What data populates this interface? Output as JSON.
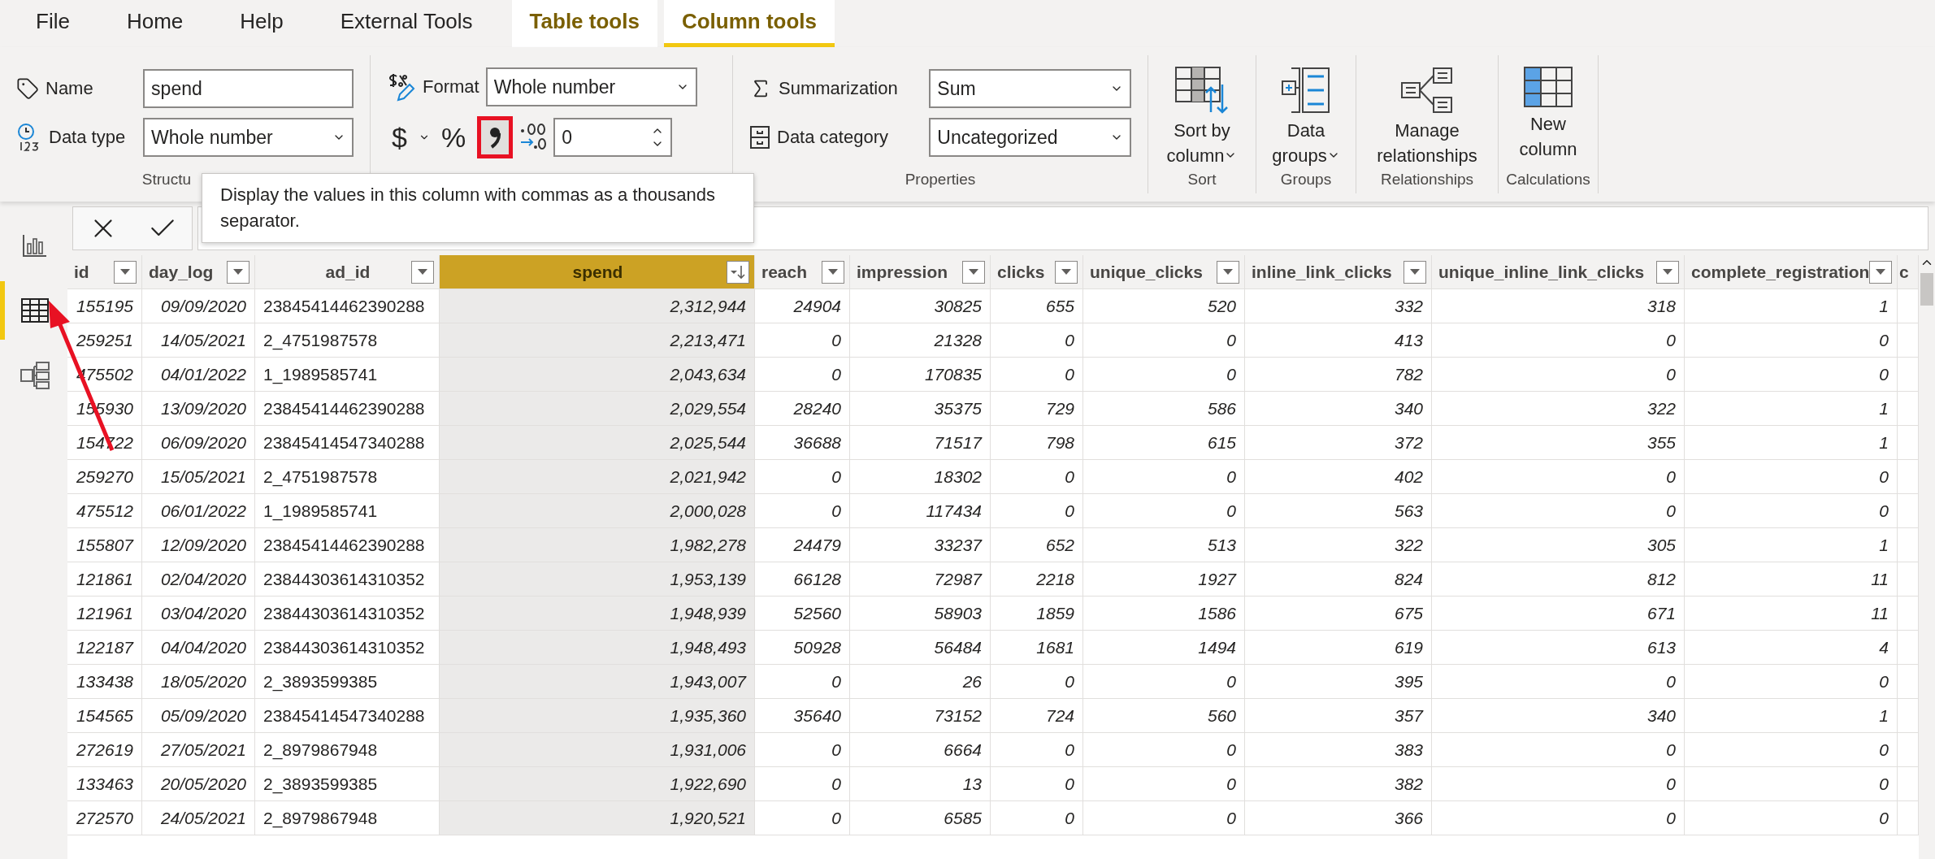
{
  "tabs": [
    {
      "label": "File",
      "selected": false,
      "kind": "normal"
    },
    {
      "label": "Home",
      "selected": false,
      "kind": "normal"
    },
    {
      "label": "Help",
      "selected": false,
      "kind": "normal"
    },
    {
      "label": "External Tools",
      "selected": false,
      "kind": "normal"
    },
    {
      "label": "Table tools",
      "selected": false,
      "kind": "contextual"
    },
    {
      "label": "Column tools",
      "selected": true,
      "kind": "contextual"
    }
  ],
  "ribbon": {
    "name": {
      "label": "Name",
      "value": "spend"
    },
    "data_type": {
      "label": "Data type",
      "value": "Whole number"
    },
    "format": {
      "label": "Format",
      "value": "Whole number"
    },
    "currency_button": "$",
    "percent_button": "%",
    "comma_highlighted": true,
    "decimals": {
      "value": "0"
    },
    "summarization": {
      "label": "Summarization",
      "value": "Sum"
    },
    "data_category": {
      "label": "Data category",
      "value": "Uncategorized"
    },
    "big_buttons": [
      {
        "kind": "sort",
        "label": "Sort by column",
        "has_menu": true
      },
      {
        "kind": "groups",
        "label": "Data groups",
        "has_menu": true
      },
      {
        "kind": "relationships",
        "label": "Manage relationships",
        "has_menu": false
      },
      {
        "kind": "new_column",
        "label": "New column",
        "has_menu": false
      }
    ],
    "group_labels": [
      "Structu",
      "Properties",
      "Sort",
      "Groups",
      "Relationships",
      "Calculations"
    ]
  },
  "tooltip": "Display the values in this column with commas as a thousands separator.",
  "sidebar": [
    {
      "kind": "report",
      "selected": false
    },
    {
      "kind": "data",
      "selected": true
    },
    {
      "kind": "model",
      "selected": false
    }
  ],
  "table": {
    "columns": [
      {
        "label": "id",
        "kind": "number",
        "selected": false,
        "sorted": false
      },
      {
        "label": "day_log",
        "kind": "number",
        "selected": false,
        "sorted": false
      },
      {
        "label": "ad_id",
        "kind": "text",
        "selected": false,
        "sorted": false
      },
      {
        "label": "spend",
        "kind": "number",
        "selected": true,
        "sorted": true
      },
      {
        "label": "reach",
        "kind": "number",
        "selected": false,
        "sorted": false
      },
      {
        "label": "impression",
        "kind": "number",
        "selected": false,
        "sorted": false
      },
      {
        "label": "clicks",
        "kind": "number",
        "selected": false,
        "sorted": false
      },
      {
        "label": "unique_clicks",
        "kind": "number",
        "selected": false,
        "sorted": false
      },
      {
        "label": "inline_link_clicks",
        "kind": "number",
        "selected": false,
        "sorted": false
      },
      {
        "label": "unique_inline_link_clicks",
        "kind": "number",
        "selected": false,
        "sorted": false
      },
      {
        "label": "complete_registration",
        "kind": "number",
        "selected": false,
        "sorted": false
      },
      {
        "label": "c",
        "kind": "partial"
      }
    ],
    "rows": [
      [
        "155195",
        "09/09/2020",
        "23845414462390288",
        "2,312,944",
        "24904",
        "30825",
        "655",
        "520",
        "332",
        "318",
        "1"
      ],
      [
        "259251",
        "14/05/2021",
        "2_4751987578",
        "2,213,471",
        "0",
        "21328",
        "0",
        "0",
        "413",
        "0",
        "0"
      ],
      [
        "475502",
        "04/01/2022",
        "1_1989585741",
        "2,043,634",
        "0",
        "170835",
        "0",
        "0",
        "782",
        "0",
        "0"
      ],
      [
        "155930",
        "13/09/2020",
        "23845414462390288",
        "2,029,554",
        "28240",
        "35375",
        "729",
        "586",
        "340",
        "322",
        "1"
      ],
      [
        "154722",
        "06/09/2020",
        "23845414547340288",
        "2,025,544",
        "36688",
        "71517",
        "798",
        "615",
        "372",
        "355",
        "1"
      ],
      [
        "259270",
        "15/05/2021",
        "2_4751987578",
        "2,021,942",
        "0",
        "18302",
        "0",
        "0",
        "402",
        "0",
        "0"
      ],
      [
        "475512",
        "06/01/2022",
        "1_1989585741",
        "2,000,028",
        "0",
        "117434",
        "0",
        "0",
        "563",
        "0",
        "0"
      ],
      [
        "155807",
        "12/09/2020",
        "23845414462390288",
        "1,982,278",
        "24479",
        "33237",
        "652",
        "513",
        "322",
        "305",
        "1"
      ],
      [
        "121861",
        "02/04/2020",
        "23844303614310352",
        "1,953,139",
        "66128",
        "72987",
        "2218",
        "1927",
        "824",
        "812",
        "11"
      ],
      [
        "121961",
        "03/04/2020",
        "23844303614310352",
        "1,948,939",
        "52560",
        "58903",
        "1859",
        "1586",
        "675",
        "671",
        "11"
      ],
      [
        "122187",
        "04/04/2020",
        "23844303614310352",
        "1,948,493",
        "50928",
        "56484",
        "1681",
        "1494",
        "619",
        "613",
        "4"
      ],
      [
        "133438",
        "18/05/2020",
        "2_3893599385",
        "1,943,007",
        "0",
        "26",
        "0",
        "0",
        "395",
        "0",
        "0"
      ],
      [
        "154565",
        "05/09/2020",
        "23845414547340288",
        "1,935,360",
        "35640",
        "73152",
        "724",
        "560",
        "357",
        "340",
        "1"
      ],
      [
        "272619",
        "27/05/2021",
        "2_8979867948",
        "1,931,006",
        "0",
        "6664",
        "0",
        "0",
        "383",
        "0",
        "0"
      ],
      [
        "133463",
        "20/05/2020",
        "2_3893599385",
        "1,922,690",
        "0",
        "13",
        "0",
        "0",
        "382",
        "0",
        "0"
      ],
      [
        "272570",
        "24/05/2021",
        "2_8979867948",
        "1,920,521",
        "0",
        "6585",
        "0",
        "0",
        "366",
        "0",
        "0"
      ]
    ]
  }
}
